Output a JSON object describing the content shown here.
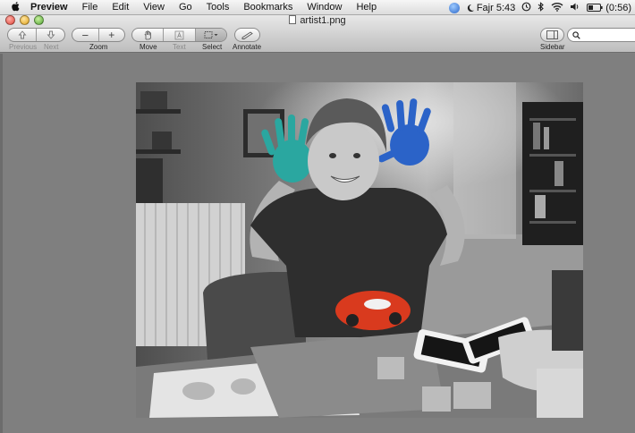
{
  "menubar": {
    "app_name": "Preview",
    "items": [
      "File",
      "Edit",
      "View",
      "Go",
      "Tools",
      "Bookmarks",
      "Window",
      "Help"
    ],
    "status": {
      "prayer_time": "Fajr 5:43",
      "battery": "(0:56)"
    }
  },
  "window": {
    "title": "artist1.png"
  },
  "toolbar": {
    "previous_label": "Previous",
    "next_label": "Next",
    "zoom_label": "Zoom",
    "move_label": "Move",
    "text_label": "Text",
    "select_label": "Select",
    "annotate_label": "Annotate",
    "sidebar_label": "Sidebar",
    "zoom_out_glyph": "−",
    "zoom_in_glyph": "+"
  },
  "icons": {
    "apple": "apple-icon",
    "search": "search-icon",
    "wifi": "wifi-icon",
    "volume": "volume-icon",
    "battery": "battery-icon"
  },
  "colors": {
    "canvas": "#7f7f7f",
    "toolbar_top": "#e8e8e8",
    "toolbar_bottom": "#bdbdbd",
    "paint_blue": "#2b63c8",
    "paint_teal": "#2aa7a0",
    "shirt_logo_red": "#d93a1e"
  }
}
